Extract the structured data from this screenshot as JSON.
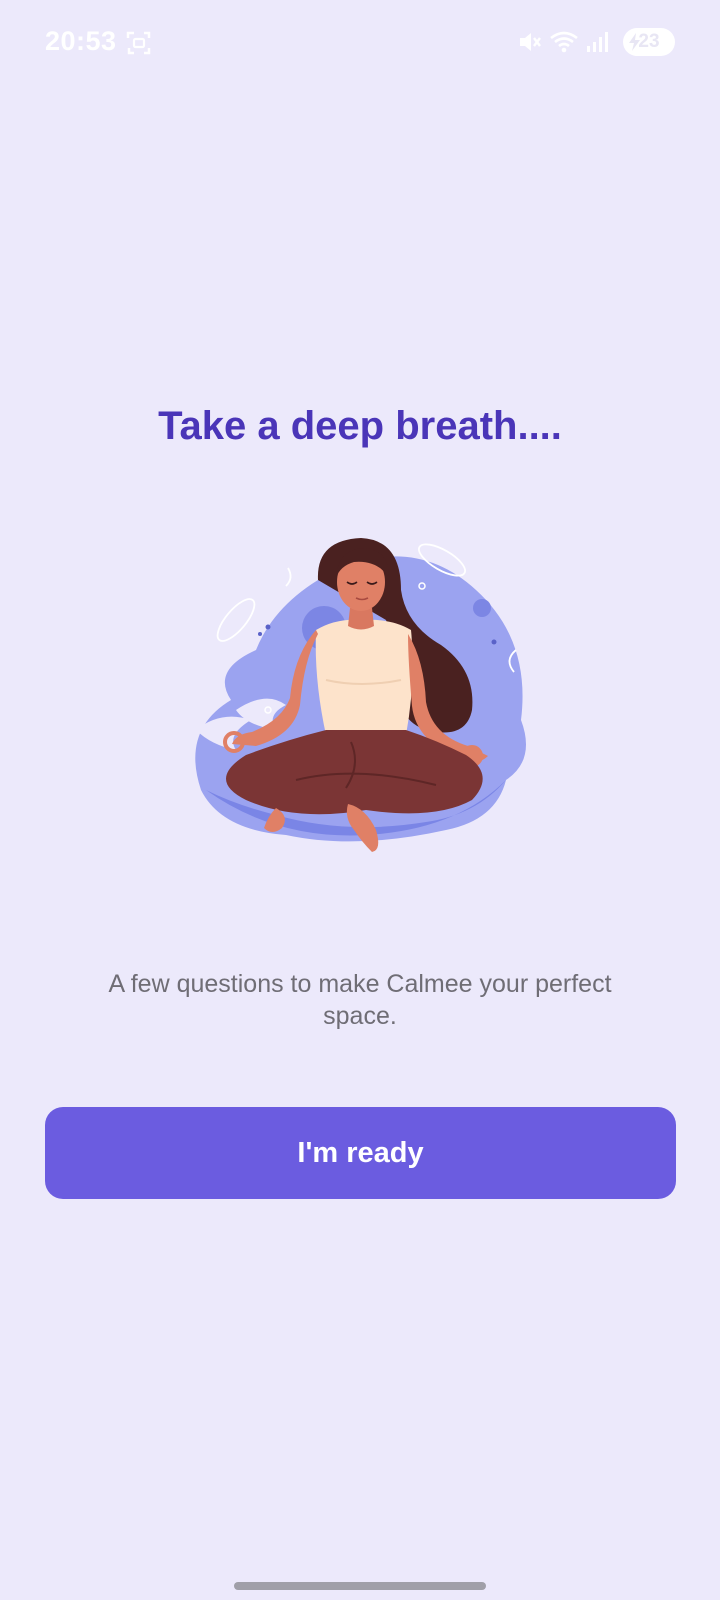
{
  "status_bar": {
    "time": "20:53",
    "battery_level": "23",
    "icons": [
      "screenshot-icon",
      "mute-icon",
      "wifi-icon",
      "signal-icon",
      "battery-icon"
    ]
  },
  "onboarding": {
    "title": "Take a deep breath....",
    "subtitle": "A few questions to make Calmee your perfect space.",
    "illustration": "meditating-woman-illustration"
  },
  "actions": {
    "primary_label": "I'm ready"
  },
  "colors": {
    "background": "#ece9fb",
    "title": "#4a35b8",
    "button": "#6b5ce0",
    "subtitle": "#6f6d75"
  }
}
